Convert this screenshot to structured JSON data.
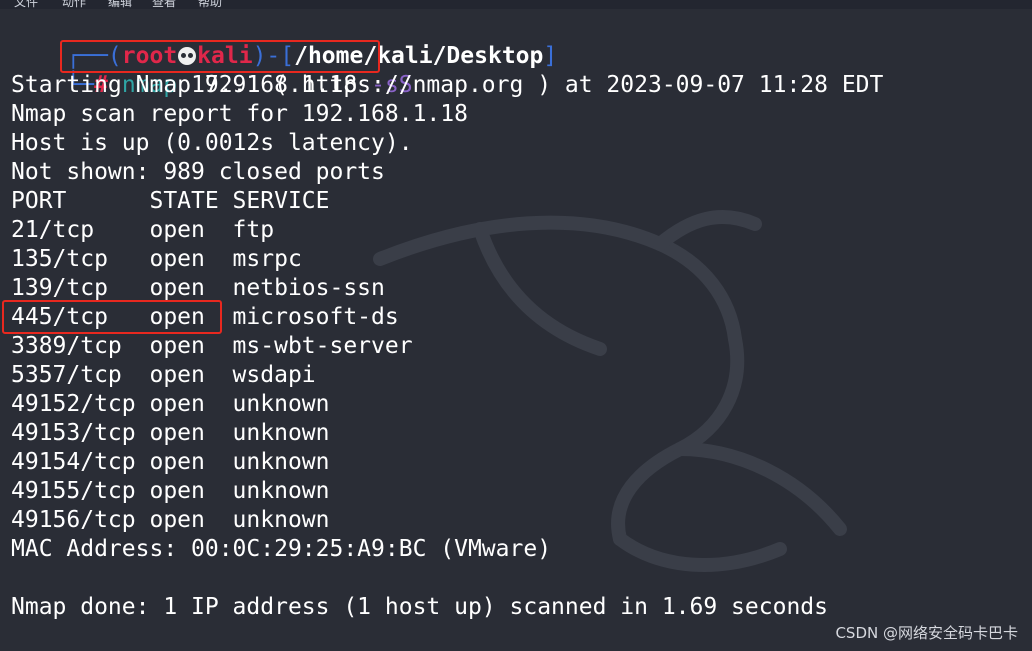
{
  "menu": [
    "文件",
    "动作",
    "编辑",
    "查看",
    "帮助"
  ],
  "prompt": {
    "frame_open": "┌──(",
    "user": "root",
    "host": "kali",
    "frame_mid": ")-[",
    "path": "/home/kali/Desktop",
    "frame_close": "]",
    "frame_bottom": "└─",
    "hash": "#"
  },
  "command": {
    "name": "nmap",
    "target": "192.168.1.18",
    "option": "-sS"
  },
  "output": {
    "starting": "Starting Nmap 7.91 ( https://nmap.org ) at 2023-09-07 11:28 EDT",
    "report": "Nmap scan report for 192.168.1.18",
    "host_up": "Host is up (0.0012s latency).",
    "not_shown": "Not shown: 989 closed ports",
    "header": "PORT      STATE SERVICE",
    "ports": [
      "21/tcp    open  ftp",
      "135/tcp   open  msrpc",
      "139/tcp   open  netbios-ssn",
      "445/tcp   open  microsoft-ds",
      "3389/tcp  open  ms-wbt-server",
      "5357/tcp  open  wsdapi",
      "49152/tcp open  unknown",
      "49153/tcp open  unknown",
      "49154/tcp open  unknown",
      "49155/tcp open  unknown",
      "49156/tcp open  unknown"
    ],
    "mac": "MAC Address: 00:0C:29:25:A9:BC (VMware)",
    "blank": "",
    "done": "Nmap done: 1 IP address (1 host up) scanned in 1.69 seconds"
  },
  "watermark": "CSDN @网络安全码卡巴卡",
  "colors": {
    "background": "#2a2d36",
    "prompt_frame": "#3a6fd8",
    "prompt_user": "#e0274a",
    "command": "#2fa5a5",
    "option": "#8a63c8",
    "highlight_box": "#e8281f"
  },
  "icons": {
    "skull": "skull-icon",
    "background_logo": "kali-dragon-icon"
  }
}
